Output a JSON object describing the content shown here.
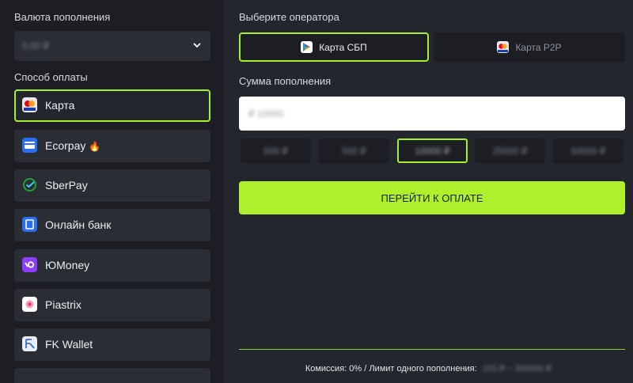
{
  "left_panel": {
    "currency_label": "Валюта пополнения",
    "currency_value": "0.00 ₽",
    "payment_method_label": "Способ оплаты",
    "methods": [
      {
        "name": "Карта",
        "icon": "bank-card-icon",
        "active": true
      },
      {
        "name": "Ecorpay",
        "icon": "ecorpay-card-icon",
        "badge": "🔥"
      },
      {
        "name": "SberPay",
        "icon": "sberpay-icon"
      },
      {
        "name": "Онлайн банк",
        "icon": "online-bank-icon"
      },
      {
        "name": "ЮMoney",
        "icon": "yoomoney-icon"
      },
      {
        "name": "Piastrix",
        "icon": "piastrix-icon"
      },
      {
        "name": "FK Wallet",
        "icon": "fk-wallet-icon"
      }
    ]
  },
  "right_panel": {
    "operator_label": "Выберите оператора",
    "operators": [
      {
        "name": "Карта СБП",
        "icon": "sbp-icon",
        "active": true
      },
      {
        "name": "Карта P2P",
        "icon": "mastercard-icon",
        "active": false
      }
    ],
    "amount_label": "Сумма пополнения",
    "amount_placeholder": "₽ 10000",
    "presets": [
      "500 ₽",
      "500 ₽",
      "10000 ₽",
      "25000 ₽",
      "50000 ₽"
    ],
    "active_preset_index": 2,
    "pay_button": "ПЕРЕЙТИ К ОПЛАТЕ",
    "footer_text": "Комиссия: 0% / Лимит одного пополнения:",
    "footer_limit": "100 ₽ – 300000 ₽"
  },
  "colors": {
    "accent": "#aef02c",
    "panel_bg": "#1c1e23",
    "item_bg": "#2a2d33"
  }
}
